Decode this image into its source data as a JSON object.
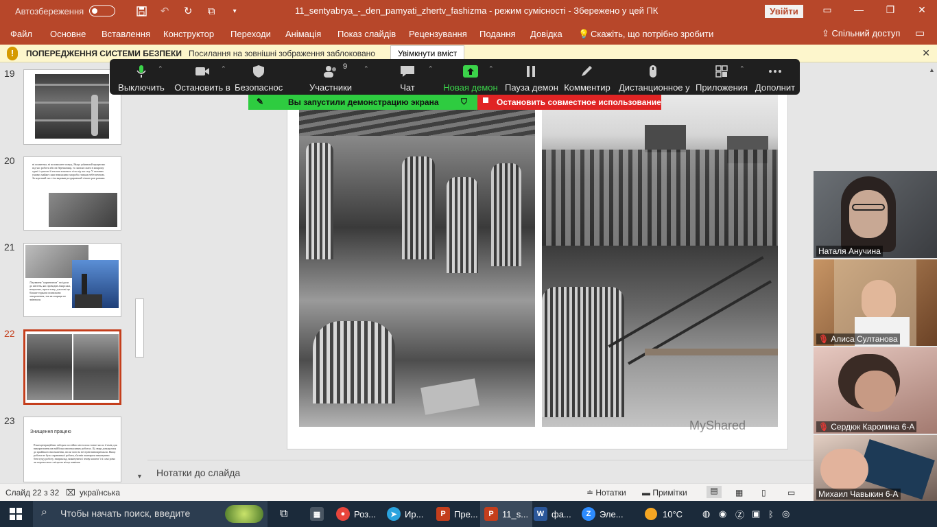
{
  "titlebar": {
    "autosave_label": "Автозбереження",
    "doc_title": "11_sentyabrya_-_den_pamyati_zhertv_fashizma  -  режим сумісності  -  Збережено у цей ПК",
    "signin_label": "Увійти"
  },
  "ribbon": {
    "tabs": [
      "Файл",
      "Основне",
      "Вставлення",
      "Конструктор",
      "Переходи",
      "Анімація",
      "Показ слайдів",
      "Рецензування",
      "Подання",
      "Довідка"
    ],
    "tellme": "Скажіть, що потрібно зробити",
    "share": "Спільний доступ"
  },
  "security_bar": {
    "title": "ПОПЕРЕДЖЕННЯ СИСТЕМИ БЕЗПЕКИ",
    "message": "Посилання на зовнішні зображення заблоковано",
    "enable_button": "Увімкнути вміст"
  },
  "thumbnails": [
    {
      "number": "19",
      "text": ""
    },
    {
      "number": "20",
      "text": "ні помиттям, ні вспоможете повуц. Якщо уя'явимой працюємо під час роботи або на берешачиці, то лягали спати в мокрому одязі і сушили її теплом власного тіла під час сну. У таємних умовах майже сама неможливо хвороба ставала небезпечною. За короткий час тіла вкривав роздираючий сіткою ран ранами."
    },
    {
      "number": "21",
      "text": "Лікування \"карантином\" засідали до кінзень, які проводив лікарськи, нещасних, проти тому, для нові ця більше торкали помилково захоронення, так як шприци не зміювали."
    },
    {
      "number": "22",
      "text": ""
    },
    {
      "number": "23",
      "title": "Знищення працею",
      "text": "В концентраційних таборах постійно містилося тонне число її вмів для використання на найбільш виснажливих роботах. Ці люди доводилися до крайнього виснаження, після чого на нестріні виноирюмали. Якщо роботи не було справжньої роботи, в'язнів часнирала виконувати безглузду роботу, наприклад, виконувати і знову копати 'ї зі самі рови чи переносити з місця на місце каміння"
    }
  ],
  "notes_placeholder": "Нотатки до слайда",
  "watermark": "MyShared",
  "statusbar": {
    "slide_info": "Слайд 22 з 32",
    "language": "українська",
    "notes": "Нотатки",
    "comments": "Примітки"
  },
  "zoom_toolbar": {
    "items": [
      {
        "label": "Выключить",
        "icon": "microphone-icon"
      },
      {
        "label": "Остановить в",
        "icon": "video-camera-icon"
      },
      {
        "label": "Безопаснос",
        "icon": "shield-icon"
      },
      {
        "label": "Участники",
        "icon": "participants-icon",
        "count": "9"
      },
      {
        "label": "Чат",
        "icon": "chat-icon"
      },
      {
        "label": "Новая демон",
        "icon": "share-screen-icon"
      },
      {
        "label": "Пауза демон",
        "icon": "pause-icon"
      },
      {
        "label": "Комментир",
        "icon": "pen-icon"
      },
      {
        "label": "Дистанционное у",
        "icon": "mouse-icon"
      },
      {
        "label": "Приложения",
        "icon": "apps-icon"
      },
      {
        "label": "Дополнит",
        "icon": "more-icon"
      }
    ],
    "sharing_banner": "Вы запустили демонстрацию экрана",
    "stop_share": "Остановить совместное использование"
  },
  "participants": [
    {
      "name": "Наталя Анучина",
      "muted": false
    },
    {
      "name": "Алиса Султанова",
      "muted": true
    },
    {
      "name": "Сердюк Каролина 6-А",
      "muted": true
    },
    {
      "name": "Михаил Чавыкин 6-А",
      "muted": false
    }
  ],
  "taskbar": {
    "search_placeholder": "Чтобы начать поиск, введите",
    "apps": [
      {
        "label": "Роз...",
        "icon": "chrome-icon",
        "color": "#e8453c"
      },
      {
        "label": "Ир...",
        "icon": "telegram-icon",
        "color": "#2aa3de"
      },
      {
        "label": "Пре...",
        "icon": "powerpoint-icon",
        "color": "#c43e1c"
      },
      {
        "label": "11_s...",
        "icon": "powerpoint-icon",
        "color": "#c43e1c"
      },
      {
        "label": "фа...",
        "icon": "word-icon",
        "color": "#2b579a"
      },
      {
        "label": "Эле...",
        "icon": "zoom-icon",
        "color": "#2d8cff"
      }
    ],
    "weather": "10°C"
  }
}
